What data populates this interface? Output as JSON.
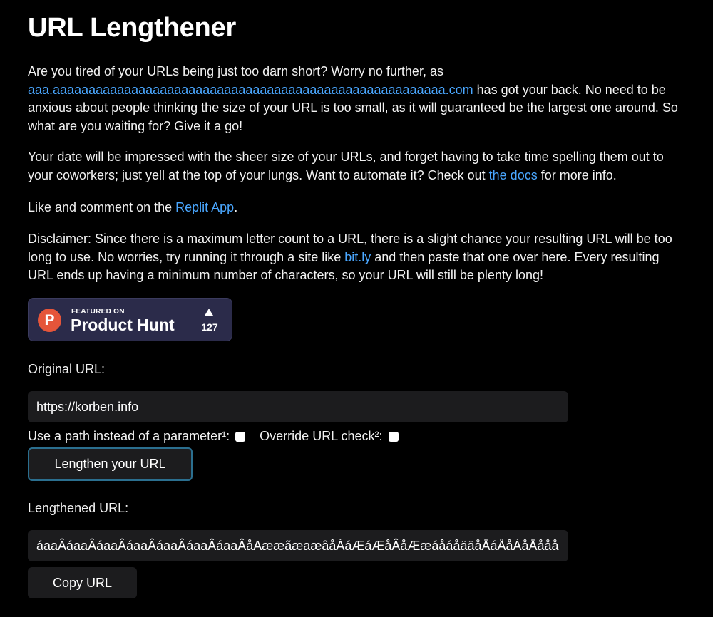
{
  "title": "URL Lengthener",
  "intro": {
    "p1_part1": "Are you tired of your URLs being just too darn short? Worry no further, as ",
    "p1_link": "aaa.aaaaaaaaaaaaaaaaaaaaaaaaaaaaaaaaaaaaaaaaaaaaaaaaaaaaaaa.com",
    "p1_part2": " has got your back. No need to be anxious about people thinking the size of your URL is too small, as it will guaranteed be the largest one around. So what are you waiting for? Give it a go!",
    "p2_part1": "Your date will be impressed with the sheer size of your URLs, and forget having to take time spelling them out to your coworkers; just yell at the top of your lungs. Want to automate it? Check out ",
    "p2_link": "the docs",
    "p2_part2": " for more info.",
    "p3_part1": "Like and comment on the ",
    "p3_link": "Replit App",
    "p3_part2": ".",
    "p4_part1": "Disclaimer: Since there is a maximum letter count to a URL, there is a slight chance your resulting URL will be too long to use. No worries, try running it through a site like ",
    "p4_link": "bit.ly",
    "p4_part2": " and then paste that one over here. Every resulting URL ends up having a minimum number of characters, so your URL will still be plenty long!"
  },
  "product_hunt": {
    "logo_letter": "P",
    "featured": "FEATURED ON",
    "name": "Product Hunt",
    "votes": "127",
    "logo_color": "#e5553a"
  },
  "form": {
    "original_label": "Original URL:",
    "original_value": "https://korben.info",
    "path_option_label": "Use a path instead of a parameter¹:",
    "override_option_label": "Override URL check²:",
    "lengthen_button": "Lengthen your URL",
    "lengthened_label": "Lengthened URL:",
    "lengthened_value": "áaaÂáaaÂáaaÂáaaÂáaaÂáaaÂáaaÂåAææãæaæâåÁáÆáÆåÂåÆæáåáåääåÅáÅåÀåÅååå",
    "copy_button": "Copy URL"
  },
  "colors": {
    "background": "#000000",
    "link": "#4aa7ff",
    "field": "#1c1c1e",
    "focus_border": "#2b6f8f"
  }
}
